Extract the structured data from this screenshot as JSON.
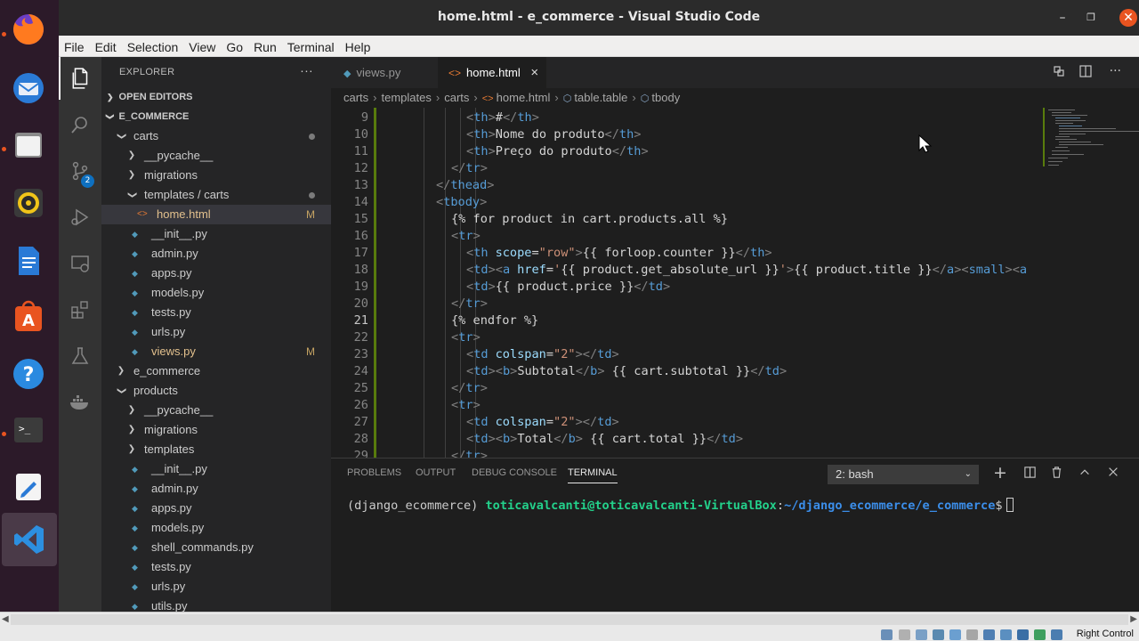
{
  "window": {
    "title": "home.html - e_commerce - Visual Studio Code"
  },
  "menu": [
    "File",
    "Edit",
    "Selection",
    "View",
    "Go",
    "Run",
    "Terminal",
    "Help"
  ],
  "dock": {
    "items": [
      "firefox-icon",
      "thunderbird-icon",
      "files-icon",
      "rhythmbox-icon",
      "libreoffice-writer-icon",
      "app-center-icon",
      "help-icon",
      "terminal-icon",
      "text-editor-icon",
      "vscode-icon"
    ]
  },
  "activity": {
    "scm_badge": "2"
  },
  "explorer": {
    "header": "EXPLORER",
    "more": "···",
    "open_editors": "OPEN EDITORS",
    "project": "E_COMMERCE",
    "tree": [
      {
        "label": "carts",
        "depth": 1,
        "type": "folder-open",
        "dot": true
      },
      {
        "label": "__pycache__",
        "depth": 2,
        "type": "folder"
      },
      {
        "label": "migrations",
        "depth": 2,
        "type": "folder"
      },
      {
        "label": "templates / carts",
        "depth": 2,
        "type": "folder-open",
        "dot": true
      },
      {
        "label": "home.html",
        "depth": 3,
        "type": "html",
        "badge": "M",
        "selected": true,
        "modified": true
      },
      {
        "label": "__init__.py",
        "depth": 2,
        "type": "py"
      },
      {
        "label": "admin.py",
        "depth": 2,
        "type": "py"
      },
      {
        "label": "apps.py",
        "depth": 2,
        "type": "py"
      },
      {
        "label": "models.py",
        "depth": 2,
        "type": "py"
      },
      {
        "label": "tests.py",
        "depth": 2,
        "type": "py"
      },
      {
        "label": "urls.py",
        "depth": 2,
        "type": "py"
      },
      {
        "label": "views.py",
        "depth": 2,
        "type": "py",
        "badge": "M",
        "modified": true
      },
      {
        "label": "e_commerce",
        "depth": 1,
        "type": "folder"
      },
      {
        "label": "products",
        "depth": 1,
        "type": "folder-open"
      },
      {
        "label": "__pycache__",
        "depth": 2,
        "type": "folder"
      },
      {
        "label": "migrations",
        "depth": 2,
        "type": "folder"
      },
      {
        "label": "templates",
        "depth": 2,
        "type": "folder"
      },
      {
        "label": "__init__.py",
        "depth": 2,
        "type": "py"
      },
      {
        "label": "admin.py",
        "depth": 2,
        "type": "py"
      },
      {
        "label": "apps.py",
        "depth": 2,
        "type": "py"
      },
      {
        "label": "models.py",
        "depth": 2,
        "type": "py"
      },
      {
        "label": "shell_commands.py",
        "depth": 2,
        "type": "py"
      },
      {
        "label": "tests.py",
        "depth": 2,
        "type": "py"
      },
      {
        "label": "urls.py",
        "depth": 2,
        "type": "py"
      },
      {
        "label": "utils.py",
        "depth": 2,
        "type": "py"
      }
    ]
  },
  "tabs": [
    {
      "label": "views.py",
      "active": false
    },
    {
      "label": "home.html",
      "active": true,
      "close": "×"
    }
  ],
  "breadcrumb": [
    "carts",
    "templates",
    "carts",
    "home.html",
    "table.table",
    "tbody"
  ],
  "editor": {
    "current_line": 21,
    "lines": [
      {
        "n": 9,
        "indent": 4,
        "tokens": [
          [
            "br",
            "<"
          ],
          [
            "tag",
            "th"
          ],
          [
            "br",
            ">"
          ],
          [
            "txt",
            "#"
          ],
          [
            "br",
            "</"
          ],
          [
            "tag",
            "th"
          ],
          [
            "br",
            ">"
          ]
        ]
      },
      {
        "n": 10,
        "indent": 4,
        "tokens": [
          [
            "br",
            "<"
          ],
          [
            "tag",
            "th"
          ],
          [
            "br",
            ">"
          ],
          [
            "txt",
            "Nome do produto"
          ],
          [
            "br",
            "</"
          ],
          [
            "tag",
            "th"
          ],
          [
            "br",
            ">"
          ]
        ]
      },
      {
        "n": 11,
        "indent": 4,
        "tokens": [
          [
            "br",
            "<"
          ],
          [
            "tag",
            "th"
          ],
          [
            "br",
            ">"
          ],
          [
            "txt",
            "Preço do produto"
          ],
          [
            "br",
            "</"
          ],
          [
            "tag",
            "th"
          ],
          [
            "br",
            ">"
          ]
        ]
      },
      {
        "n": 12,
        "indent": 3,
        "tokens": [
          [
            "br",
            "</"
          ],
          [
            "tag",
            "tr"
          ],
          [
            "br",
            ">"
          ]
        ]
      },
      {
        "n": 13,
        "indent": 2,
        "tokens": [
          [
            "br",
            "</"
          ],
          [
            "tag",
            "thead"
          ],
          [
            "br",
            ">"
          ]
        ]
      },
      {
        "n": 14,
        "indent": 2,
        "tokens": [
          [
            "br",
            "<"
          ],
          [
            "tag",
            "tbody"
          ],
          [
            "br",
            ">"
          ]
        ]
      },
      {
        "n": 15,
        "indent": 3,
        "tokens": [
          [
            "txt",
            "{% for product in cart.products.all %}"
          ]
        ]
      },
      {
        "n": 16,
        "indent": 3,
        "tokens": [
          [
            "br",
            "<"
          ],
          [
            "tag",
            "tr"
          ],
          [
            "br",
            ">"
          ]
        ]
      },
      {
        "n": 17,
        "indent": 4,
        "tokens": [
          [
            "br",
            "<"
          ],
          [
            "tag",
            "th"
          ],
          [
            "attr",
            "scope"
          ],
          [
            "txt",
            "="
          ],
          [
            "str",
            "\"row\""
          ],
          [
            "br",
            ">"
          ],
          [
            "txt",
            "{{ forloop.counter }}"
          ],
          [
            "br",
            "</"
          ],
          [
            "tag",
            "th"
          ],
          [
            "br",
            ">"
          ]
        ]
      },
      {
        "n": 18,
        "indent": 4,
        "tokens": [
          [
            "br",
            "<"
          ],
          [
            "tag",
            "td"
          ],
          [
            "br",
            ">"
          ],
          [
            "br",
            "<"
          ],
          [
            "tag",
            "a"
          ],
          [
            "attr",
            "href"
          ],
          [
            "txt",
            "="
          ],
          [
            "str",
            "'"
          ],
          [
            "txt",
            "{{ product.get_absolute_url }}"
          ],
          [
            "str",
            "'"
          ],
          [
            "br",
            ">"
          ],
          [
            "txt",
            "{{ product.title }}"
          ],
          [
            "br",
            "</"
          ],
          [
            "tag",
            "a"
          ],
          [
            "br",
            ">"
          ],
          [
            "br",
            "<"
          ],
          [
            "tag",
            "small"
          ],
          [
            "br",
            ">"
          ],
          [
            "br",
            "<"
          ],
          [
            "tag",
            "a"
          ]
        ]
      },
      {
        "n": 19,
        "indent": 4,
        "tokens": [
          [
            "br",
            "<"
          ],
          [
            "tag",
            "td"
          ],
          [
            "br",
            ">"
          ],
          [
            "txt",
            "{{ product.price }}"
          ],
          [
            "br",
            "</"
          ],
          [
            "tag",
            "td"
          ],
          [
            "br",
            ">"
          ]
        ]
      },
      {
        "n": 20,
        "indent": 3,
        "tokens": [
          [
            "br",
            "</"
          ],
          [
            "tag",
            "tr"
          ],
          [
            "br",
            ">"
          ]
        ]
      },
      {
        "n": 21,
        "indent": 3,
        "tokens": [
          [
            "txt",
            "{% endfor %}"
          ]
        ]
      },
      {
        "n": 22,
        "indent": 3,
        "tokens": [
          [
            "br",
            "<"
          ],
          [
            "tag",
            "tr"
          ],
          [
            "br",
            ">"
          ]
        ]
      },
      {
        "n": 23,
        "indent": 4,
        "tokens": [
          [
            "br",
            "<"
          ],
          [
            "tag",
            "td"
          ],
          [
            "attr",
            "colspan"
          ],
          [
            "txt",
            "="
          ],
          [
            "str",
            "\"2\""
          ],
          [
            "br",
            ">"
          ],
          [
            "br",
            "</"
          ],
          [
            "tag",
            "td"
          ],
          [
            "br",
            ">"
          ]
        ]
      },
      {
        "n": 24,
        "indent": 4,
        "tokens": [
          [
            "br",
            "<"
          ],
          [
            "tag",
            "td"
          ],
          [
            "br",
            ">"
          ],
          [
            "br",
            "<"
          ],
          [
            "tag",
            "b"
          ],
          [
            "br",
            ">"
          ],
          [
            "txt",
            "Subtotal"
          ],
          [
            "br",
            "</"
          ],
          [
            "tag",
            "b"
          ],
          [
            "br",
            ">"
          ],
          [
            "txt",
            " {{ cart.subtotal }}"
          ],
          [
            "br",
            "</"
          ],
          [
            "tag",
            "td"
          ],
          [
            "br",
            ">"
          ]
        ]
      },
      {
        "n": 25,
        "indent": 3,
        "tokens": [
          [
            "br",
            "</"
          ],
          [
            "tag",
            "tr"
          ],
          [
            "br",
            ">"
          ]
        ]
      },
      {
        "n": 26,
        "indent": 3,
        "tokens": [
          [
            "br",
            "<"
          ],
          [
            "tag",
            "tr"
          ],
          [
            "br",
            ">"
          ]
        ]
      },
      {
        "n": 27,
        "indent": 4,
        "tokens": [
          [
            "br",
            "<"
          ],
          [
            "tag",
            "td"
          ],
          [
            "attr",
            "colspan"
          ],
          [
            "txt",
            "="
          ],
          [
            "str",
            "\"2\""
          ],
          [
            "br",
            ">"
          ],
          [
            "br",
            "</"
          ],
          [
            "tag",
            "td"
          ],
          [
            "br",
            ">"
          ]
        ]
      },
      {
        "n": 28,
        "indent": 4,
        "tokens": [
          [
            "br",
            "<"
          ],
          [
            "tag",
            "td"
          ],
          [
            "br",
            ">"
          ],
          [
            "br",
            "<"
          ],
          [
            "tag",
            "b"
          ],
          [
            "br",
            ">"
          ],
          [
            "txt",
            "Total"
          ],
          [
            "br",
            "</"
          ],
          [
            "tag",
            "b"
          ],
          [
            "br",
            ">"
          ],
          [
            "txt",
            " {{ cart.total }}"
          ],
          [
            "br",
            "</"
          ],
          [
            "tag",
            "td"
          ],
          [
            "br",
            ">"
          ]
        ]
      },
      {
        "n": 29,
        "indent": 3,
        "tokens": [
          [
            "br",
            "</"
          ],
          [
            "tag",
            "tr"
          ],
          [
            "br",
            ">"
          ]
        ]
      }
    ]
  },
  "panel": {
    "tabs": [
      "PROBLEMS",
      "OUTPUT",
      "DEBUG CONSOLE",
      "TERMINAL"
    ],
    "active_tab": "TERMINAL",
    "terminal_select": "2: bash",
    "prompt_env": "(django_ecommerce) ",
    "prompt_user": "toticavalcanti@toticavalcanti-VirtualBox",
    "prompt_sep": ":",
    "prompt_path": "~/django_ecommerce/e_commerce",
    "prompt_end": "$"
  },
  "host": {
    "right_control": "Right Control"
  },
  "colors": {
    "accent": "#e95420",
    "tag": "#569cd6",
    "attr": "#9cdcfe",
    "string": "#ce9178",
    "git_added": "#587c0c"
  }
}
